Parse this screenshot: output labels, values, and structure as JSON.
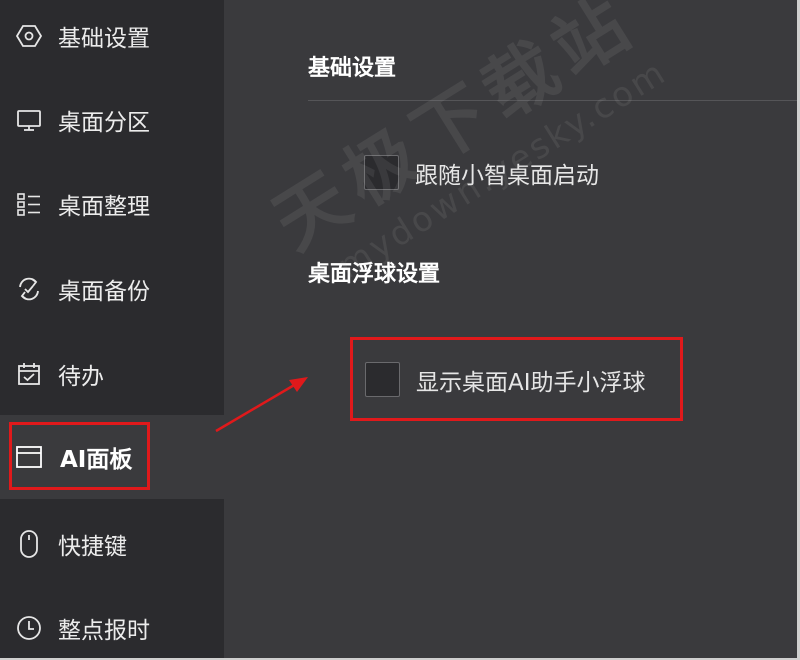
{
  "sidebar": {
    "items": [
      {
        "label": "基础设置",
        "icon": "hexagon-settings-icon"
      },
      {
        "label": "桌面分区",
        "icon": "monitor-icon"
      },
      {
        "label": "桌面整理",
        "icon": "grid-list-icon"
      },
      {
        "label": "桌面备份",
        "icon": "sync-backup-icon"
      },
      {
        "label": "待办",
        "icon": "calendar-check-icon"
      },
      {
        "label": "AI面板",
        "icon": "panel-window-icon",
        "active": true
      },
      {
        "label": "快捷键",
        "icon": "mouse-icon"
      },
      {
        "label": "整点报时",
        "icon": "clock-icon"
      }
    ]
  },
  "main": {
    "sections": [
      {
        "title": "基础设置",
        "options": [
          {
            "label": "跟随小智桌面启动",
            "checked": false
          }
        ]
      },
      {
        "title": "桌面浮球设置",
        "options": [
          {
            "label": "显示桌面AI助手小浮球",
            "checked": false
          }
        ]
      }
    ]
  },
  "watermark": {
    "main": "天极下载站",
    "sub": "mydown.yesky.com"
  },
  "colors": {
    "sidebar_bg": "#2b2b2e",
    "content_bg": "#3a3a3d",
    "highlight": "#e0191b"
  }
}
